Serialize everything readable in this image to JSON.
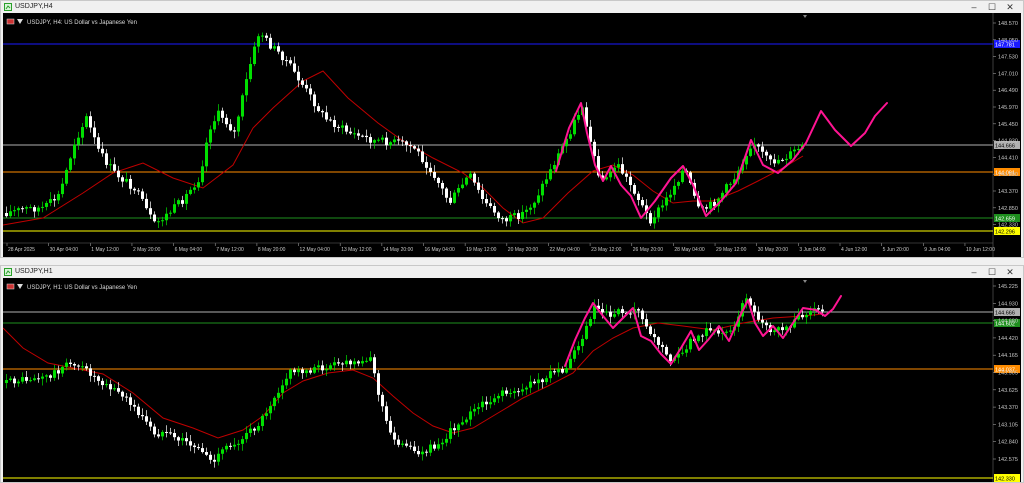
{
  "charts": [
    {
      "window_title": "USDJPY,H4",
      "header": "USDJPY, H4:  US Dollar vs Japanese Yen",
      "price_labels": [
        "148.570",
        "148.050",
        "147.530",
        "147.010",
        "146.490",
        "145.970",
        "145.450",
        "144.930",
        "144.410",
        "143.890",
        "143.370",
        "142.850",
        "142.330"
      ],
      "time_labels": [
        "28 Apr 2025",
        "30 Apr 04:00",
        "1 May 12:00",
        "2 May 20:00",
        "6 May 04:00",
        "7 May 12:00",
        "8 May 20:00",
        "12 May 04:00",
        "13 May 12:00",
        "14 May 20:00",
        "16 May 04:00",
        "19 May 12:00",
        "20 May 20:00",
        "22 May 04:00",
        "23 May 12:00",
        "26 May 20:00",
        "28 May 04:00",
        "29 May 12:00",
        "30 May 20:00",
        "3 Jun 04:00",
        "4 Jun 12:00",
        "5 Jun 20:00",
        "9 Jun 04:00",
        "10 Jun 12:00"
      ],
      "hlines": [
        {
          "label": "147.781",
          "color": "#1a1aff"
        },
        {
          "label": "144.666",
          "color": "#b0b0b0"
        },
        {
          "label": "144.091",
          "color": "#ff8c00"
        },
        {
          "label": "142.659",
          "color": "#1e8f1e"
        },
        {
          "label": "142.296",
          "color": "#ffff00"
        }
      ]
    },
    {
      "window_title": "USDJPY,H1",
      "header": "USDJPY, H1:  US Dollar vs Japanese Yen",
      "price_labels": [
        "145.225",
        "144.930",
        "144.680",
        "144.420",
        "144.165",
        "143.905",
        "143.625",
        "143.370",
        "143.105",
        "142.840",
        "142.575"
      ],
      "time_labels": [],
      "hlines": [
        {
          "label": "144.666",
          "color": "#b0b0b0"
        },
        {
          "label": "144.602",
          "color": "#1e8f1e"
        },
        {
          "label": "144.037",
          "color": "#ff8c00"
        },
        {
          "label": "142.330",
          "color": "#ffff00"
        }
      ]
    }
  ],
  "window_buttons": [
    "–",
    "☐",
    "✕"
  ],
  "colors": {
    "bull": "#00e000",
    "bear": "#ffffff",
    "ma": "#c00000",
    "projection": "#ff1493",
    "grid_text": "#c8c8c8"
  }
}
